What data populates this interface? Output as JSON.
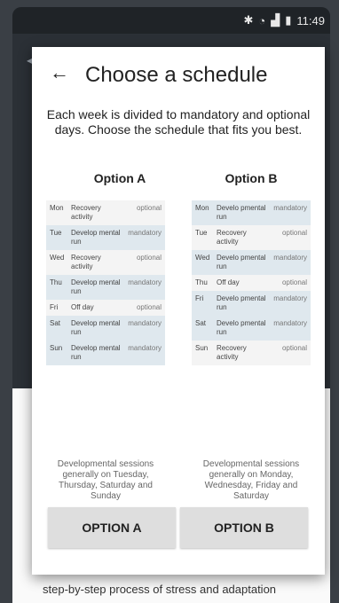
{
  "status": {
    "icons": [
      "bluetooth-icon",
      "wifi-icon",
      "signal-icon",
      "battery-icon"
    ],
    "time": "11:49"
  },
  "dialog": {
    "title": "Choose a schedule",
    "description": "Each week is divided to mandatory and optional days. Choose the schedule that fits you best."
  },
  "option_a": {
    "header": "Option A",
    "rows": [
      {
        "day": "Mon",
        "activity": "Recovery activity",
        "type": "optional"
      },
      {
        "day": "Tue",
        "activity": "Develop mental run",
        "type": "mandatory"
      },
      {
        "day": "Wed",
        "activity": "Recovery activity",
        "type": "optional"
      },
      {
        "day": "Thu",
        "activity": "Develop mental run",
        "type": "mandatory"
      },
      {
        "day": "Fri",
        "activity": "Off day",
        "type": "optional"
      },
      {
        "day": "Sat",
        "activity": "Develop mental run",
        "type": "mandatory"
      },
      {
        "day": "Sun",
        "activity": "Develop mental run",
        "type": "mandatory"
      }
    ],
    "description": "Developmental sessions generally on Tuesday, Thursday, Saturday and Sunday",
    "button": "OPTION A"
  },
  "option_b": {
    "header": "Option B",
    "rows": [
      {
        "day": "Mon",
        "activity": "Develo pmental run",
        "type": "mandatory"
      },
      {
        "day": "Tue",
        "activity": "Recovery activity",
        "type": "optional"
      },
      {
        "day": "Wed",
        "activity": "Develo pmental run",
        "type": "mandatory"
      },
      {
        "day": "Thu",
        "activity": "Off day",
        "type": "optional"
      },
      {
        "day": "Fri",
        "activity": "Develo pmental run",
        "type": "mandatory"
      },
      {
        "day": "Sat",
        "activity": "Develo pmental run",
        "type": "mandatory"
      },
      {
        "day": "Sun",
        "activity": "Recovery activity",
        "type": "optional"
      }
    ],
    "description": "Developmental sessions generally on Monday, Wednesday, Friday and Saturday",
    "button": "OPTION B"
  },
  "background": {
    "text": "step-by-step process of stress and adaptation"
  },
  "colors": {
    "mandatory_row": "#dfe8ee",
    "optional_row": "#f4f4f4",
    "button": "#dedede"
  }
}
